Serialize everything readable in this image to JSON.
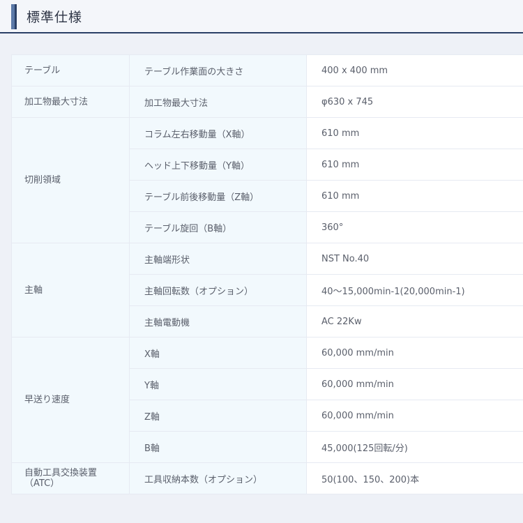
{
  "header": {
    "title": "標準仕様"
  },
  "spec_table": {
    "groups": [
      {
        "category": "テーブル",
        "rows": [
          {
            "item": "テーブル作業面の大きさ",
            "value": "400 x 400 mm"
          }
        ]
      },
      {
        "category": "加工物最大寸法",
        "rows": [
          {
            "item": "加工物最大寸法",
            "value": "φ630 x 745"
          }
        ]
      },
      {
        "category": "切削領域",
        "rows": [
          {
            "item": "コラム左右移動量（X軸）",
            "value": "610 mm"
          },
          {
            "item": "ヘッド上下移動量（Y軸）",
            "value": "610 mm"
          },
          {
            "item": "テーブル前後移動量（Z軸）",
            "value": "610 mm"
          },
          {
            "item": "テーブル旋回（B軸）",
            "value": "360°"
          }
        ]
      },
      {
        "category": "主軸",
        "rows": [
          {
            "item": "主軸端形状",
            "value": "NST No.40"
          },
          {
            "item": "主軸回転数（オプション）",
            "value": "40～15,000min-1(20,000min-1)"
          },
          {
            "item": "主軸電動機",
            "value": "AC 22Kw"
          }
        ]
      },
      {
        "category": "早送り速度",
        "rows": [
          {
            "item": "X軸",
            "value": "60,000 mm/min"
          },
          {
            "item": "Y軸",
            "value": "60,000 mm/min"
          },
          {
            "item": "Z軸",
            "value": "60,000 mm/min"
          },
          {
            "item": "B軸",
            "value": "45,000(125回転/分)"
          }
        ]
      },
      {
        "category": "自動工具交換装置\n（ATC）",
        "rows": [
          {
            "item": "工具収納本数（オプション）",
            "value": "50(100、150、200)本"
          }
        ]
      }
    ]
  }
}
